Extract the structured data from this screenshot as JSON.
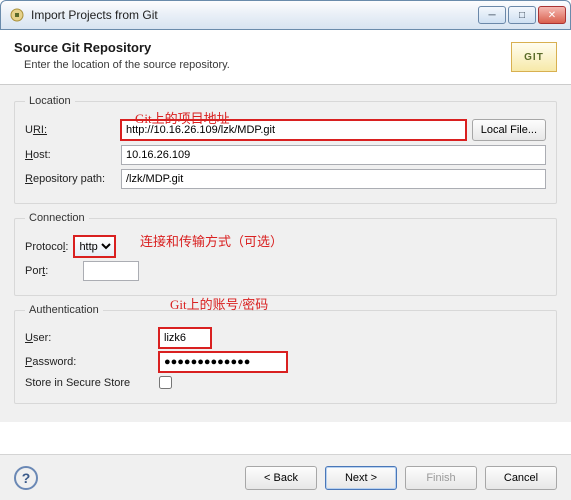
{
  "window": {
    "title": "Import Projects from Git"
  },
  "header": {
    "title": "Source Git Repository",
    "subtitle": "Enter the location of the source repository.",
    "logo_text": "GIT"
  },
  "location": {
    "legend": "Location",
    "uri_label": "RI:",
    "uri_value": "http://10.16.26.109/lzk/MDP.git",
    "localfile_label": "Local File...",
    "host_label": "ost:",
    "host_value": "10.16.26.109",
    "repo_label": "epository path:",
    "repo_value": "/lzk/MDP.git"
  },
  "connection": {
    "legend": "Connection",
    "protocol_label": "Protoco",
    "protocol_l": "l",
    "protocol_value": "http",
    "port_label": "Por",
    "port_t": "t",
    "port_value": ""
  },
  "auth": {
    "legend": "Authentication",
    "user_label": "ser:",
    "user_value": "lizk6",
    "pass_label": "assword:",
    "pass_value": "●●●●●●●●●●●●●",
    "store_label": "Store in Secure Store"
  },
  "footer": {
    "back": "< Back",
    "next": "Next >",
    "finish": "Finish",
    "cancel": "Cancel"
  },
  "annotations": {
    "uri": "Git上的项目地址",
    "protocol": "连接和传输方式（可选）",
    "auth": "Git上的账号/密码"
  }
}
